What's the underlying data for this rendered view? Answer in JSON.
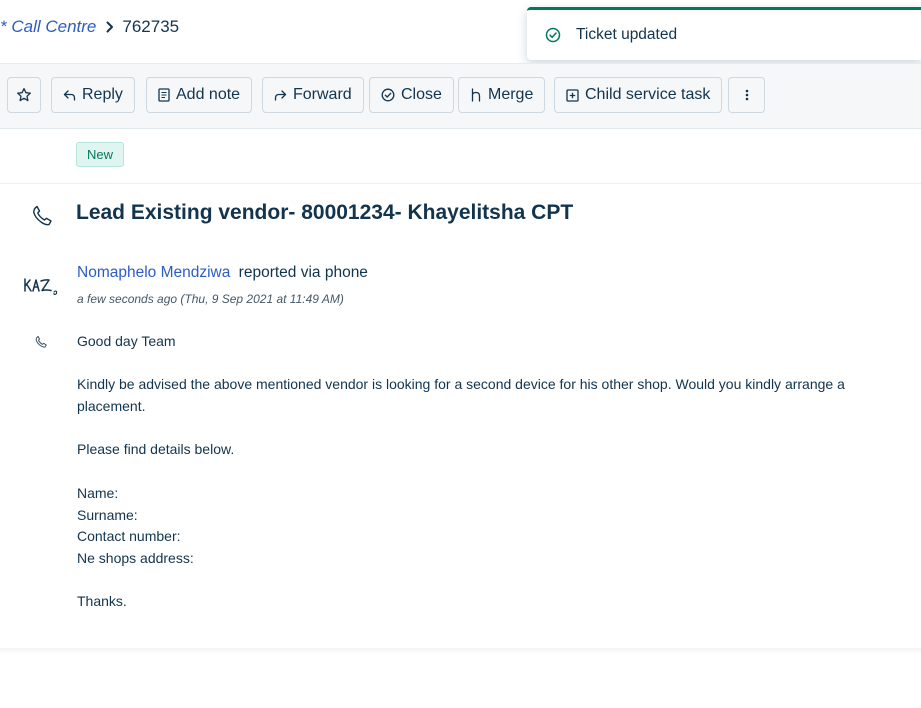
{
  "breadcrumb": {
    "parent": "* Call Centre",
    "ticket_id": "762735"
  },
  "toast": {
    "text": "Ticket updated",
    "icon": "check-circle-icon",
    "accent_color": "#00795b"
  },
  "toolbar": {
    "star_icon": "star-icon",
    "reply_label": "Reply",
    "add_note_label": "Add note",
    "forward_label": "Forward",
    "close_label": "Close",
    "merge_label": "Merge",
    "child_task_label": "Child service task",
    "more_icon": "more-vertical-icon"
  },
  "ticket": {
    "status": "New",
    "source_icon": "phone-icon",
    "title": "Lead Existing vendor- 80001234- Khayelitsha CPT",
    "requester": {
      "name": "Nomaphelo Mendziwa",
      "via_text": "reported via phone",
      "time": "a few seconds ago (Thu, 9 Sep 2021 at 11:49 AM)"
    },
    "message_lines": [
      "Good day Team",
      "",
      "Kindly be advised the above mentioned vendor is looking for a second device for his other shop. Would you kindly arrange a placement.",
      "",
      "Please find details below.",
      "",
      "Name:",
      "Surname:",
      "Contact number:",
      "Ne shops address:",
      "",
      "Thanks."
    ]
  },
  "colors": {
    "link": "#2c5cc5",
    "text": "#12344d",
    "status_green": "#00795b"
  }
}
